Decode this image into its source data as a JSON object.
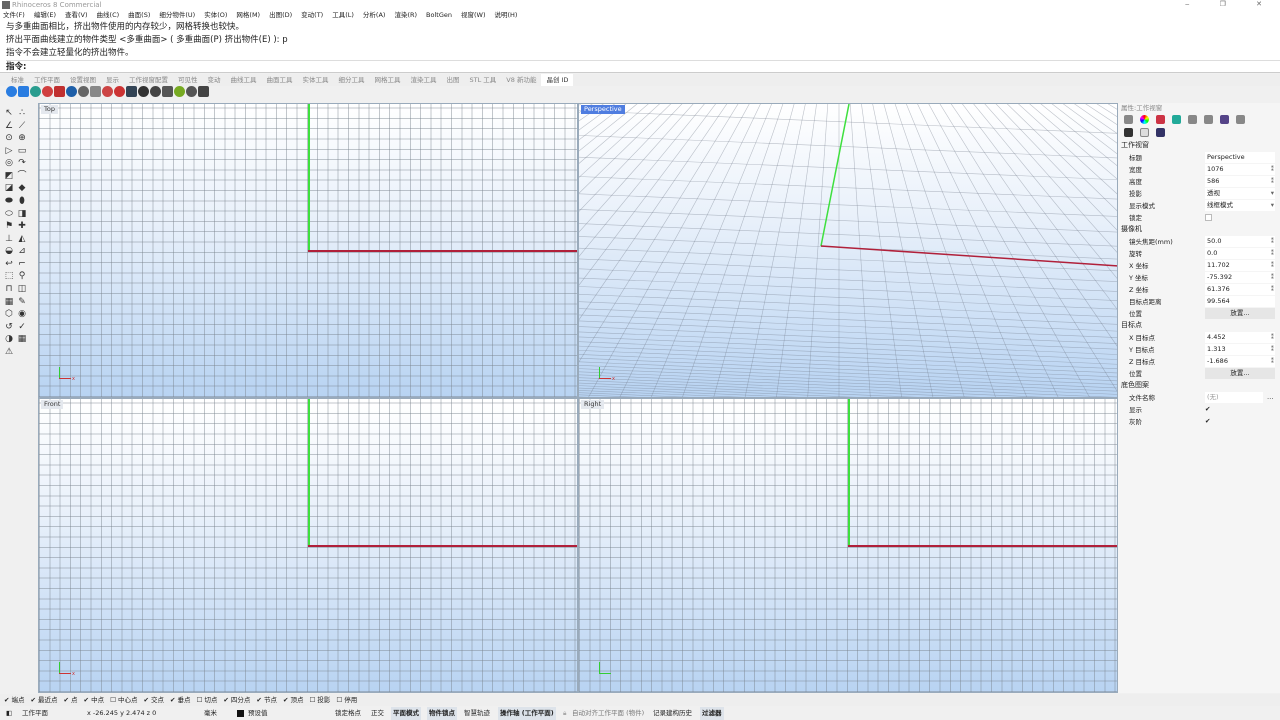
{
  "title": "Rhinoceros 8 Commercial",
  "menu": [
    "文件(F)",
    "编辑(E)",
    "查看(V)",
    "曲线(C)",
    "曲面(S)",
    "细分物件(U)",
    "实体(O)",
    "网格(M)",
    "出图(D)",
    "变动(T)",
    "工具(L)",
    "分析(A)",
    "渲染(R)",
    "BoltGen",
    "视窗(W)",
    "说明(H)"
  ],
  "command": {
    "history": [
      "与多重曲面相比，挤出物件使用的内存较少，网格转换也较快。",
      "挤出平面曲线建立的物件类型 <多重曲面> ( 多重曲面(P)  挤出物件(E) ): p",
      "指令不会建立轻量化的挤出物件。"
    ],
    "prompt": "指令:"
  },
  "tabs": [
    "标准",
    "工作平面",
    "设置视图",
    "显示",
    "工作视窗配置",
    "可见性",
    "变动",
    "曲线工具",
    "曲面工具",
    "实体工具",
    "细分工具",
    "网格工具",
    "渲染工具",
    "出图",
    "STL 工具",
    "V8 新功能",
    "晶创 ID"
  ],
  "active_tab": "晶创 ID",
  "viewports": {
    "top": "Top",
    "perspective": "Perspective",
    "front": "Front",
    "right": "Right"
  },
  "panel": {
    "header": "属性:工作视窗",
    "sec_viewport": "工作视窗",
    "rows1": [
      {
        "k": "标题",
        "v": "Perspective"
      },
      {
        "k": "宽度",
        "v": "1076"
      },
      {
        "k": "高度",
        "v": "586"
      },
      {
        "k": "投影",
        "v": "透视"
      },
      {
        "k": "显示模式",
        "v": "线框模式"
      }
    ],
    "lock": "锁定",
    "sec_camera": "摄像机",
    "rows2": [
      {
        "k": "镜头焦距(mm)",
        "v": "50.0"
      },
      {
        "k": "旋转",
        "v": "0.0"
      },
      {
        "k": "X 坐标",
        "v": "11.702"
      },
      {
        "k": "Y 坐标",
        "v": "-75.392"
      },
      {
        "k": "Z 坐标",
        "v": "61.376"
      },
      {
        "k": "目标点距离",
        "v": "99.564"
      }
    ],
    "position": "位置",
    "place": "放置...",
    "sec_target": "目标点",
    "rows3": [
      {
        "k": "X 目标点",
        "v": "4.452"
      },
      {
        "k": "Y 目标点",
        "v": "1.313"
      },
      {
        "k": "Z 目标点",
        "v": "-1.686"
      }
    ],
    "sec_wallpaper": "底色图案",
    "filename": "文件名称",
    "filename_v": "(无)",
    "show": "显示",
    "gray": "灰阶"
  },
  "snaps": [
    {
      "l": "端点",
      "c": true
    },
    {
      "l": "最近点",
      "c": true
    },
    {
      "l": "点",
      "c": true
    },
    {
      "l": "中点",
      "c": true
    },
    {
      "l": "中心点",
      "c": false
    },
    {
      "l": "交点",
      "c": true
    },
    {
      "l": "垂点",
      "c": true
    },
    {
      "l": "切点",
      "c": false
    },
    {
      "l": "四分点",
      "c": true
    },
    {
      "l": "节点",
      "c": true
    },
    {
      "l": "顶点",
      "c": true
    },
    {
      "l": "投影",
      "c": false
    },
    {
      "l": "停用",
      "c": false
    }
  ],
  "status": {
    "cplane": "工作平面",
    "coords": "x -26.245  y 2.474  z 0",
    "units": "毫米",
    "layer": "预设值",
    "grid_snap": "锁定格点",
    "ortho": "正交",
    "planar": "平面模式",
    "osnap": "物件锁点",
    "smarttrack": "智慧轨迹",
    "gumball": "操作轴 (工作平面)",
    "autocplane": "自动对齐工作平面 (物件)",
    "history": "记录建构历史",
    "filter": "过滤器"
  }
}
